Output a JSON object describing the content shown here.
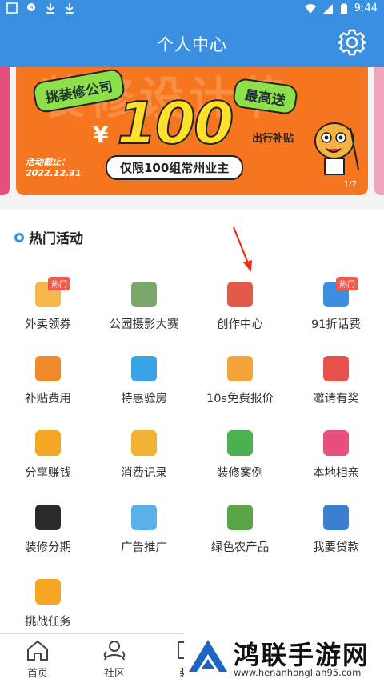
{
  "status_bar": {
    "time": "9:44",
    "icons": [
      "image-icon",
      "notification-app-icon",
      "download-icon",
      "download-icon",
      "wifi-icon",
      "signal-icon",
      "battery-icon"
    ]
  },
  "header": {
    "title": "个人中心",
    "settings_icon": "gear-icon",
    "bg_color": "#3a8fe0"
  },
  "banner": {
    "company": "挑装修公司",
    "most": "最高送",
    "currency": "¥",
    "amount": "100",
    "subsidy": "出行补贴",
    "deadline_label": "活动截止：",
    "deadline_date": "2022.12.31",
    "limit_text": "仅限100组常州业主",
    "pager": "1/2",
    "bg_color": "#f5761e"
  },
  "section": {
    "title": "热门活动"
  },
  "grid": {
    "hot_label": "热门",
    "items": [
      {
        "label": "外卖领券",
        "icon": "takeout-coupon-icon",
        "hot": true,
        "color": "#f7b84b"
      },
      {
        "label": "公园摄影大赛",
        "icon": "park-photo-icon",
        "hot": false,
        "color": "#7aa86a"
      },
      {
        "label": "创作中心",
        "icon": "creator-center-icon",
        "hot": false,
        "color": "#e25b4a"
      },
      {
        "label": "91折话费",
        "icon": "phone-bill-icon",
        "hot": true,
        "color": "#3a8fe0"
      },
      {
        "label": "补贴费用",
        "icon": "subsidy-icon",
        "hot": false,
        "color": "#ef8a2a"
      },
      {
        "label": "特惠验房",
        "icon": "house-inspection-icon",
        "hot": false,
        "color": "#3aa3e6"
      },
      {
        "label": "10s免费报价",
        "icon": "free-quote-icon",
        "hot": false,
        "color": "#f2a33a"
      },
      {
        "label": "邀请有奖",
        "icon": "invite-envelope-icon",
        "hot": false,
        "color": "#e8514a"
      },
      {
        "label": "分享赚钱",
        "icon": "share-money-icon",
        "hot": false,
        "color": "#f5a623"
      },
      {
        "label": "消费记录",
        "icon": "basket-icon",
        "hot": false,
        "color": "#f2b233"
      },
      {
        "label": "装修案例",
        "icon": "building-case-icon",
        "hot": false,
        "color": "#4cb050"
      },
      {
        "label": "本地相亲",
        "icon": "heart-icon",
        "hot": false,
        "color": "#e84f7c"
      },
      {
        "label": "装修分期",
        "icon": "installment-icon",
        "hot": false,
        "color": "#2b2b2b"
      },
      {
        "label": "广告推广",
        "icon": "ad-promo-icon",
        "hot": false,
        "color": "#5ab0e8"
      },
      {
        "label": "绿色农产品",
        "icon": "green-produce-icon",
        "hot": false,
        "color": "#5aa646"
      },
      {
        "label": "我要贷款",
        "icon": "loan-icon",
        "hot": false,
        "color": "#3a7fd0"
      },
      {
        "label": "挑战任务",
        "icon": "task-icon",
        "hot": false,
        "color": "#f5a623"
      }
    ]
  },
  "bottom_nav": {
    "items": [
      {
        "label": "首页",
        "icon": "home-icon"
      },
      {
        "label": "社区",
        "icon": "community-icon"
      },
      {
        "label": "装",
        "icon": "decoration-icon"
      }
    ]
  },
  "watermark": {
    "name": "鸿联手游网",
    "url": "www.henanhonglian95.com"
  }
}
